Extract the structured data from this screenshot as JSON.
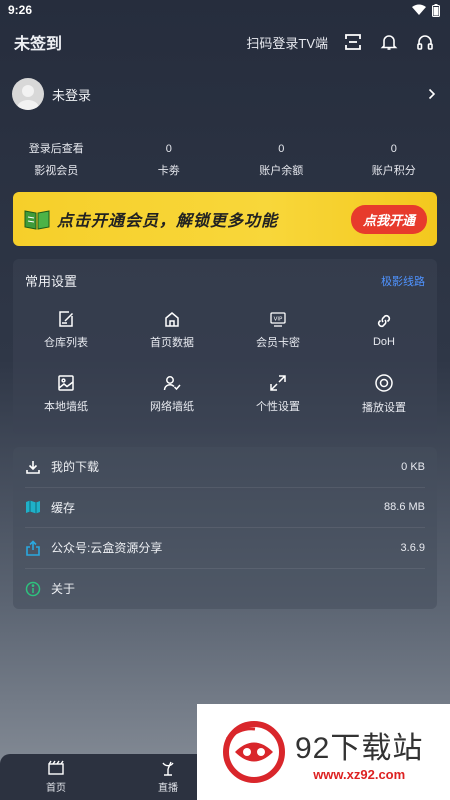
{
  "status": {
    "time": "9:26"
  },
  "header": {
    "title": "未签到",
    "scan_label": "扫码登录TV端"
  },
  "user": {
    "name": "未登录"
  },
  "stats": [
    {
      "value": "登录后查看",
      "label": "影视会员"
    },
    {
      "value": "0",
      "label": "卡劵"
    },
    {
      "value": "0",
      "label": "账户余额"
    },
    {
      "value": "0",
      "label": "账户积分"
    }
  ],
  "banner": {
    "text": "点击开通会员，解锁更多功能",
    "button": "点我开通"
  },
  "settings": {
    "title": "常用设置",
    "link": "极影线路",
    "items": [
      {
        "label": "仓库列表",
        "icon": "edit-icon"
      },
      {
        "label": "首页数据",
        "icon": "home-icon"
      },
      {
        "label": "会员卡密",
        "icon": "vip-card-icon"
      },
      {
        "label": "DoH",
        "icon": "link-icon"
      },
      {
        "label": "本地墙纸",
        "icon": "image-icon"
      },
      {
        "label": "网络墙纸",
        "icon": "user-check-icon"
      },
      {
        "label": "个性设置",
        "icon": "expand-icon"
      },
      {
        "label": "播放设置",
        "icon": "play-circle-icon"
      }
    ]
  },
  "list": [
    {
      "label": "我的下载",
      "value": "0 KB",
      "icon": "download-icon"
    },
    {
      "label": "缓存",
      "value": "88.6 MB",
      "icon": "map-icon"
    },
    {
      "label": "公众号:云盒资源分享",
      "value": "3.6.9",
      "icon": "share-icon"
    },
    {
      "label": "关于",
      "value": "",
      "icon": "info-icon"
    }
  ],
  "nav": [
    {
      "label": "首页",
      "icon": "film-icon"
    },
    {
      "label": "直播",
      "icon": "antenna-icon"
    }
  ],
  "watermark": {
    "title": "92下载站",
    "url": "www.xz92.com"
  }
}
